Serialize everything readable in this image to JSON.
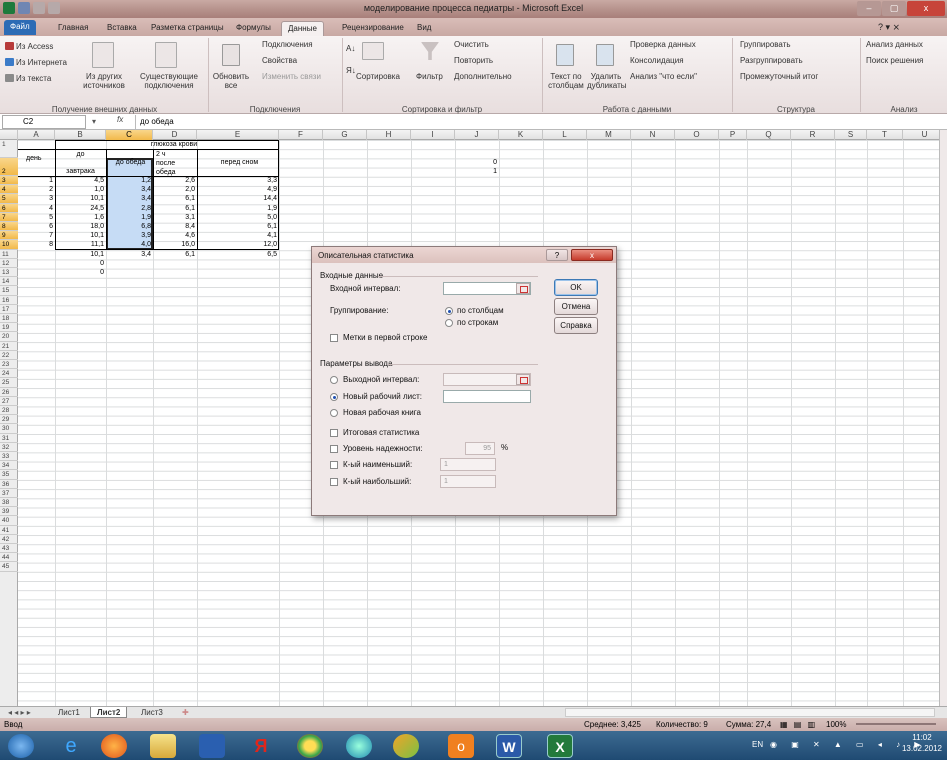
{
  "window": {
    "title": "моделирование процесса  педиатры  -  Microsoft Excel",
    "controls": [
      "–",
      "▢",
      "x"
    ]
  },
  "ribbon_tabs": [
    "Файл",
    "Главная",
    "Вставка",
    "Разметка страницы",
    "Формулы",
    "Данные",
    "Рецензирование",
    "Вид"
  ],
  "ribbon": {
    "external": {
      "items": [
        "Из Access",
        "Из Интернета",
        "Из текста"
      ],
      "other_sources": "Из других источников",
      "existing": "Существующие подключения",
      "group_label": "Получение внешних данных"
    },
    "connections": {
      "refresh": "Обновить все",
      "items": [
        "Подключения",
        "Свойства",
        "Изменить связи"
      ],
      "group_label": "Подключения"
    },
    "sort_filter": {
      "sort": "Сортировка",
      "filter": "Фильтр",
      "items": [
        "Очистить",
        "Повторить",
        "Дополнительно"
      ],
      "group_label": "Сортировка и фильтр"
    },
    "data_tools": {
      "text_to_columns": "Текст по столбцам",
      "remove_duplicates": "Удалить дубликаты",
      "items": [
        "Проверка данных",
        "Консолидация",
        "Анализ \"что если\""
      ],
      "group_label": "Работа с данными"
    },
    "outline": {
      "items": [
        "Группировать",
        "Разгруппировать",
        "Промежуточный итог"
      ],
      "group_label": "Структура"
    },
    "analysis": {
      "items": [
        "Анализ данных",
        "Поиск решения"
      ],
      "group_label": "Анализ"
    }
  },
  "formula_bar": {
    "name_box": "C2",
    "fx": "fx",
    "formula": "до обеда"
  },
  "columns": [
    "A",
    "B",
    "C",
    "D",
    "E",
    "F",
    "G",
    "H",
    "I",
    "J",
    "K",
    "L",
    "M",
    "N",
    "O",
    "P",
    "Q",
    "R",
    "S",
    "T",
    "U"
  ],
  "rows": [
    "1",
    "2",
    "3",
    "4",
    "5",
    "6",
    "7",
    "8",
    "9",
    "10",
    "11",
    "12",
    "13",
    "14",
    "15",
    "16",
    "17",
    "18",
    "19",
    "20",
    "21",
    "22",
    "23",
    "24",
    "25",
    "26",
    "27",
    "28",
    "29",
    "30",
    "31",
    "32",
    "33",
    "34",
    "35",
    "36",
    "37",
    "38",
    "39",
    "40",
    "41",
    "42",
    "43",
    "44",
    "45"
  ],
  "sheet": {
    "header_group": "глюкоза крови",
    "col_a_header": "день",
    "col_b_header_top": "до",
    "col_b_header_bottom": "завтрака",
    "col_c_header": "до обеда",
    "col_d_header_1": "2 ч",
    "col_d_header_2": "после",
    "col_d_header_3": "обеда",
    "col_e_header": "перед сном",
    "rows": [
      {
        "day": "1",
        "b": "4,5",
        "c": "1,2",
        "d": "2,6",
        "e": "3,3"
      },
      {
        "day": "2",
        "b": "1,0",
        "c": "3,4",
        "d": "2,0",
        "e": "4,9"
      },
      {
        "day": "3",
        "b": "10,1",
        "c": "3,4",
        "d": "6,1",
        "e": "14,4"
      },
      {
        "day": "4",
        "b": "24,5",
        "c": "2,8",
        "d": "6,1",
        "e": "1,9"
      },
      {
        "day": "5",
        "b": "1,6",
        "c": "1,9",
        "d": "3,1",
        "e": "5,0"
      },
      {
        "day": "6",
        "b": "18,0",
        "c": "6,8",
        "d": "8,4",
        "e": "6,1"
      },
      {
        "day": "7",
        "b": "10,1",
        "c": "3,9",
        "d": "4,6",
        "e": "4,1"
      },
      {
        "day": "8",
        "b": "11,1",
        "c": "4,0",
        "d": "16,0",
        "e": "12,0"
      }
    ],
    "row11": {
      "b": "10,1",
      "c": "3,4",
      "d": "6,1",
      "e": "6,5"
    },
    "row12_b": "0",
    "row13_b": "0",
    "j2": "0",
    "j3": "1"
  },
  "dialog": {
    "title": "Описательная статистика",
    "help": "?",
    "close": "x",
    "input_section": "Входные данные",
    "input_range_label": "Входной интервал:",
    "grouping_label": "Группирование:",
    "by_columns": "по столбцам",
    "by_rows": "по строкам",
    "labels_first_row": "Метки в первой строке",
    "output_section": "Параметры вывода",
    "output_range": "Выходной интервал:",
    "new_sheet": "Новый рабочий лист:",
    "new_book": "Новая рабочая книга",
    "summary_stats": "Итоговая статистика",
    "confidence": "Уровень надежности:",
    "confidence_value": "95",
    "percent": "%",
    "kth_smallest": "К-ый наименьший:",
    "kth_smallest_value": "1",
    "kth_largest": "К-ый наибольший:",
    "kth_largest_value": "1",
    "ok": "OK",
    "cancel": "Отмена",
    "help_btn": "Справка"
  },
  "sheet_tabs": [
    "Лист1",
    "Лист2",
    "Лист3"
  ],
  "status": {
    "mode": "Ввод",
    "average": "Среднее: 3,425",
    "count": "Количество: 9",
    "sum": "Сумма: 27,4",
    "zoom": "100%"
  },
  "taskbar": {
    "lang": "EN",
    "time": "11:02",
    "date": "13.02.2012"
  },
  "colors": {
    "title_bar": "#b48f89",
    "file_tab": "#2c6bb5",
    "selection": "#c6dcf5",
    "taskbar": "#2a5880"
  }
}
